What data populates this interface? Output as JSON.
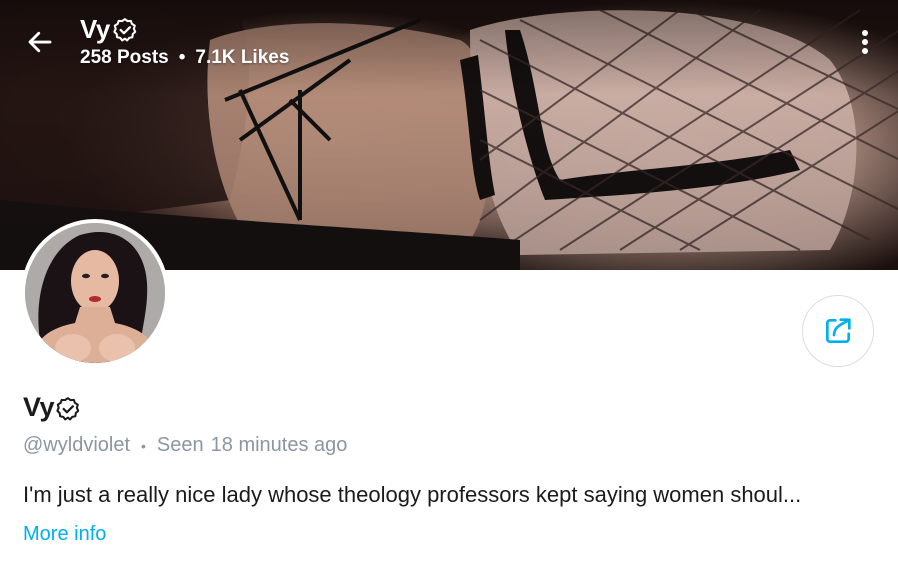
{
  "header": {
    "title": "Vy",
    "posts_count": "258",
    "posts_label": "Posts",
    "likes_count": "7.1K",
    "likes_label": "Likes",
    "separator": "•"
  },
  "profile": {
    "name": "Vy",
    "username": "@wyldviolet",
    "seen_label": "Seen",
    "seen_time": "18 minutes ago",
    "bio": "I'm just a really nice lady whose theology professors kept saying women shoul...",
    "more_info_label": "More info"
  },
  "icons": {
    "back": "arrow-left-icon",
    "verified": "verified-badge-icon",
    "menu": "more-vertical-icon",
    "share": "share-icon"
  },
  "colors": {
    "accent": "#00aff0",
    "muted_text": "#8a96a3",
    "primary_text": "#1b1b1b"
  }
}
